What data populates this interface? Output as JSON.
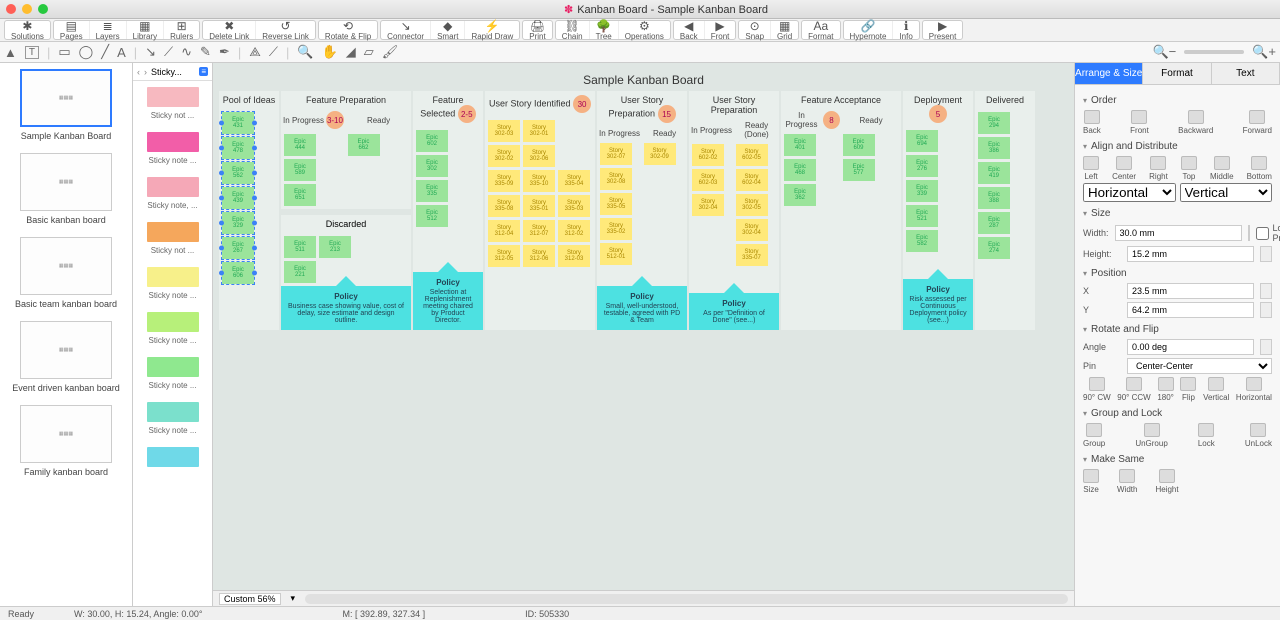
{
  "window": {
    "title": "Kanban Board - Sample Kanban Board"
  },
  "toolbar": {
    "buttons": [
      "Solutions",
      "Pages",
      "Layers",
      "Library",
      "Rulers",
      "Delete Link",
      "Reverse Link",
      "Rotate & Flip",
      "Connector",
      "Smart",
      "Rapid Draw",
      "Print",
      "Chain",
      "Tree",
      "Operations",
      "Back",
      "Front",
      "Snap",
      "Grid",
      "Format",
      "Hypernote",
      "Info",
      "Present"
    ]
  },
  "templates": [
    {
      "label": "Sample Kanban Board",
      "selected": true
    },
    {
      "label": "Basic kanban board"
    },
    {
      "label": "Basic team kanban board"
    },
    {
      "label": "Event driven kanban board"
    },
    {
      "label": "Family kanban board"
    }
  ],
  "shapes_header": "Sticky...",
  "shapes": [
    {
      "color": "#f7b9c0",
      "label": "Sticky not ..."
    },
    {
      "color": "#f25ea8",
      "label": "Sticky note ..."
    },
    {
      "color": "#f5a8b7",
      "label": "Sticky note, ..."
    },
    {
      "color": "#f5a75c",
      "label": "Sticky not ..."
    },
    {
      "color": "#f7f08a",
      "label": "Sticky note ..."
    },
    {
      "color": "#b7f07a",
      "label": "Sticky note ..."
    },
    {
      "color": "#8fe88f",
      "label": "Sticky note ..."
    },
    {
      "color": "#7be0cc",
      "label": "Sticky note ..."
    },
    {
      "color": "#6fd9e8",
      "label": ""
    }
  ],
  "board": {
    "title": "Sample Kanban Board",
    "pool": {
      "header": "Pool of Ideas",
      "wip": "",
      "cards": [
        "Epic 431",
        "Epic 478",
        "Epic 562",
        "Epic 439",
        "Epic 329",
        "Epic 267",
        "Epic 606"
      ]
    },
    "columns": [
      {
        "header": "Feature Preparation",
        "subs": [
          {
            "h": "In Progress",
            "wip": "3-10"
          },
          {
            "h": "Ready"
          }
        ],
        "subcards": [
          [
            "Epic 444",
            "Epic 589",
            "Epic 651"
          ],
          [
            "Epic 662"
          ]
        ],
        "discarded": {
          "header": "Discarded",
          "cards": [
            [
              "Epic 511",
              "Epic 213"
            ],
            [
              "Epic 221"
            ]
          ]
        },
        "policy": {
          "t": "Policy",
          "b": "Business case showing value, cost of delay, size estimate and design outline."
        }
      },
      {
        "header": "Feature Selected",
        "wip": "2-5",
        "cards": [
          "Epic 602",
          "Epic 302",
          "Epic 335",
          "Epic 512"
        ],
        "policy": {
          "t": "Policy",
          "b": "Selection at Replenishment meeting chaired by Product Director."
        }
      },
      {
        "header": "User Story Identified",
        "wip": "30",
        "rows": [
          [
            "Story 302-03",
            "Story 302-01"
          ],
          [
            "Story 302-02",
            "Story 302-06"
          ],
          [
            "Story 335-09",
            "Story 335-10",
            "Story 335-04"
          ],
          [
            "Story 335-08",
            "Story 335-01",
            "Story 335-03"
          ],
          [
            "Story 312-04",
            "Story 312-07",
            "Story 312-02"
          ],
          [
            "Story 312-05",
            "Story 312-06",
            "Story 312-03"
          ]
        ]
      },
      {
        "header": "User Story Preparation",
        "wip": "15",
        "subs": [
          {
            "h": "In Progress"
          },
          {
            "h": "Ready"
          }
        ],
        "subcards": [
          [
            "Story 302-07",
            "Story 302-08",
            "Story 335-05",
            "Story 335-02",
            "Story 512-01"
          ],
          [
            "Story 302-09",
            "",
            "",
            "",
            ""
          ]
        ],
        "policy": {
          "t": "Policy",
          "b": "Small, well-understood, testable, agreed with PD & Team"
        }
      },
      {
        "header": "User Story Preparation",
        "subs": [
          {
            "h": "In Progress"
          },
          {
            "h": "Ready (Done)"
          }
        ],
        "subcards": [
          [
            "Story 602-02",
            "Story 602-03",
            "Story 302-04",
            "",
            ""
          ],
          [
            "Story 602-05",
            "Story 602-04",
            "Story 302-05",
            "Story 302-04",
            "Story 335-07"
          ]
        ],
        "policy": {
          "t": "Policy",
          "b": "As per \"Definition of Done\" (see...)"
        }
      },
      {
        "header": "Feature Acceptance",
        "subs": [
          {
            "h": "In Progress",
            "wip": "8"
          },
          {
            "h": "Ready"
          }
        ],
        "subcards": [
          [
            "Epic 401",
            "Epic 468",
            "Epic 362"
          ],
          [
            "Epic 609",
            "Epic 577"
          ]
        ]
      },
      {
        "header": "Deployment",
        "wip": "5",
        "cards": [
          "Epic 694",
          "Epic 276",
          "Epic 339",
          "Epic 521",
          "Epic 582"
        ],
        "policy": {
          "t": "Policy",
          "b": "Risk assessed per Continuous Deployment policy (see...)"
        }
      },
      {
        "header": "Delivered",
        "cards": [
          "Epic 294",
          "Epic 386",
          "Epic 419",
          "Epic 388",
          "Epic 287",
          "Epic 274"
        ]
      }
    ]
  },
  "zoom": "Custom 56%",
  "inspector": {
    "tabs": [
      "Arrange & Size",
      "Format",
      "Text"
    ],
    "order": {
      "h": "Order",
      "btns": [
        "Back",
        "Front",
        "Backward",
        "Forward"
      ]
    },
    "align": {
      "h": "Align and Distribute",
      "btns": [
        "Left",
        "Center",
        "Right",
        "Top",
        "Middle",
        "Bottom"
      ],
      "hsel": "Horizontal",
      "vsel": "Vertical"
    },
    "size": {
      "h": "Size",
      "width": "30.0 mm",
      "height": "15.2 mm",
      "lock": "Lock Proportions"
    },
    "position": {
      "h": "Position",
      "x": "23.5 mm",
      "y": "64.2 mm"
    },
    "rotate": {
      "h": "Rotate and Flip",
      "angle": "0.00 deg",
      "pin": "Center-Center",
      "btns": [
        "90° CW",
        "90° CCW",
        "180°",
        "Flip",
        "Vertical",
        "Horizontal"
      ]
    },
    "group": {
      "h": "Group and Lock",
      "btns": [
        "Group",
        "UnGroup",
        "Lock",
        "UnLock"
      ]
    },
    "same": {
      "h": "Make Same",
      "btns": [
        "Size",
        "Width",
        "Height"
      ]
    }
  },
  "status": {
    "ready": "Ready",
    "wh": "W: 30.00,   H: 15.24,   Angle: 0.00°",
    "mouse": "M: [ 392.89, 327.34 ]",
    "id": "ID: 505330"
  }
}
